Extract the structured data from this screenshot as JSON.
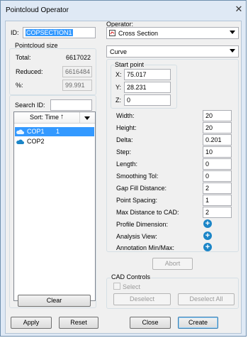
{
  "window": {
    "title": "Pointcloud Operator"
  },
  "id_field": {
    "label": "ID:",
    "value": "COPSECTION1"
  },
  "pointcloud_size": {
    "title": "Pointcloud size",
    "total_label": "Total:",
    "total_value": "6617022",
    "reduced_label": "Reduced:",
    "reduced_value": "6616484",
    "percent_label": "%:",
    "percent_value": "99.991"
  },
  "search": {
    "label": "Search ID:",
    "value": ""
  },
  "list": {
    "sort_label": "Sort: Time",
    "sort_arrow": "↑",
    "items": [
      {
        "name": "COP1",
        "count": "1",
        "selected": true
      },
      {
        "name": "COP2",
        "count": "",
        "selected": false
      }
    ]
  },
  "clear_button": "Clear",
  "operator": {
    "label": "Operator:",
    "value": "Cross Section"
  },
  "mode_select": {
    "value": "Curve"
  },
  "start_point": {
    "title": "Start point",
    "x_label": "X:",
    "x_value": "75.017",
    "y_label": "Y:",
    "y_value": "28.231",
    "z_label": "Z:",
    "z_value": "0"
  },
  "params": [
    {
      "label": "Width:",
      "value": "20"
    },
    {
      "label": "Height:",
      "value": "20"
    },
    {
      "label": "Delta:",
      "value": "0.201"
    },
    {
      "label": "Step:",
      "value": "10"
    },
    {
      "label": "Length:",
      "value": "0"
    },
    {
      "label": "Smoothing Tol:",
      "value": "0"
    },
    {
      "label": "Gap Fill Distance:",
      "value": "2"
    },
    {
      "label": "Point Spacing:",
      "value": "1"
    },
    {
      "label": "Max Distance to CAD:",
      "value": "2"
    }
  ],
  "extras": [
    {
      "label": "Profile Dimension:"
    },
    {
      "label": "Analysis View:"
    },
    {
      "label": "Annotation Min/Max:"
    }
  ],
  "plus_glyph": "+",
  "abort_button": "Abort",
  "cad_controls": {
    "title": "CAD Controls",
    "select_label": "Select",
    "deselect": "Deselect",
    "deselect_all": "Deselect All"
  },
  "bottom": {
    "apply": "Apply",
    "reset": "Reset",
    "close": "Close",
    "create": "Create"
  },
  "close_glyph": "✕",
  "colors": {
    "selection": "#3399ff",
    "accent_icon": "#1b85c7",
    "frame": "#dfe9f5"
  }
}
